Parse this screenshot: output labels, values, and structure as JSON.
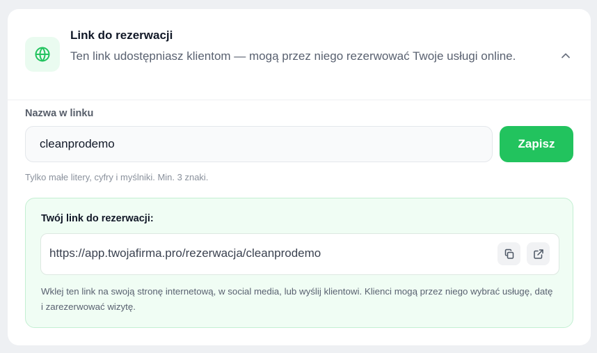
{
  "header": {
    "title": "Link do rezerwacji",
    "description": "Ten link udostępniasz klientom — mogą przez niego rezerwować Twoje usługi online.",
    "icon": "globe-icon",
    "collapse_icon": "chevron-up-icon"
  },
  "slug_field": {
    "label": "Nazwa w linku",
    "value": "cleanprodemo",
    "hint": "Tylko małe litery, cyfry i myślniki. Min. 3 znaki."
  },
  "save_button": {
    "label": "Zapisz"
  },
  "link_panel": {
    "title": "Twój link do rezerwacji:",
    "url": "https://app.twojafirma.pro/rezerwacja/cleanprodemo",
    "copy_icon": "copy-icon",
    "open_icon": "external-link-icon",
    "note": "Wklej ten link na swoją stronę internetową, w social media, lub wyślij klientowi. Klienci mogą przez niego wybrać usługę, datę i zarezerwować wizytę."
  },
  "colors": {
    "accent": "#22c35e",
    "accent_soft": "#f0fdf4",
    "page_background": "#eef0f3"
  }
}
